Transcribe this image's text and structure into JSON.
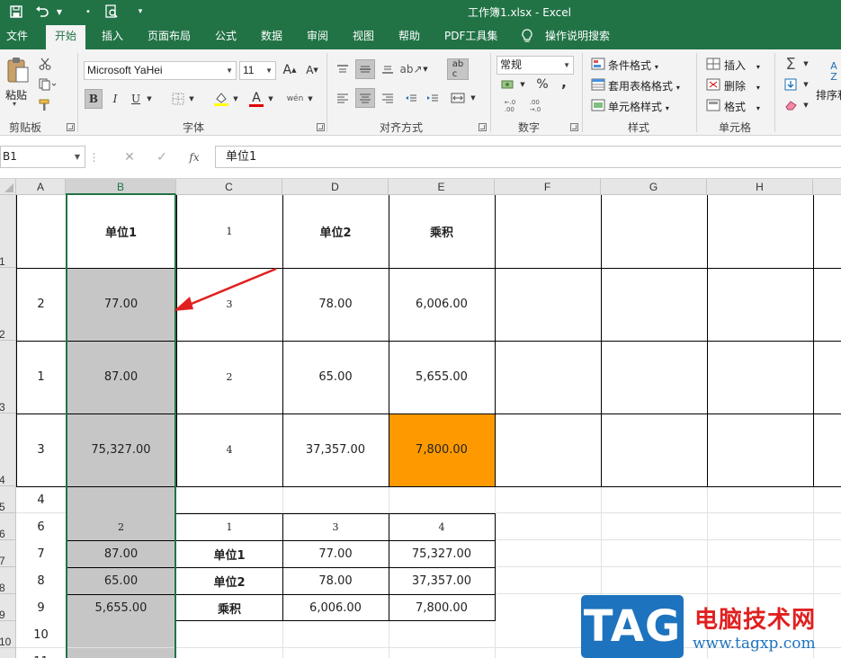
{
  "window": {
    "title": "工作簿1.xlsx  -  Excel"
  },
  "tabs": [
    "文件",
    "开始",
    "插入",
    "页面布局",
    "公式",
    "数据",
    "审阅",
    "视图",
    "帮助",
    "PDF工具集",
    "操作说明搜索"
  ],
  "ribbon": {
    "clipboard": {
      "paste": "粘贴",
      "label": "剪贴板"
    },
    "font": {
      "family": "Microsoft YaHei",
      "size": "11",
      "label": "字体",
      "bold": "B",
      "italic": "I",
      "underline": "U",
      "grow": "A",
      "shrink": "A",
      "font_color": "A"
    },
    "alignment": {
      "label": "对齐方式"
    },
    "number": {
      "format": "常规",
      "percent": "%",
      "comma": ",",
      "label": "数字"
    },
    "styles": {
      "conditional": "条件格式",
      "table": "套用表格格式",
      "cell_style": "单元格样式",
      "label": "样式"
    },
    "cells": {
      "insert": "插入",
      "delete": "删除",
      "format": "格式",
      "label": "单元格"
    },
    "editing": {
      "sort": "排序和"
    }
  },
  "formula_bar": {
    "name_box": "B1",
    "fx": "fx",
    "content": "单位1"
  },
  "columns": [
    "A",
    "B",
    "C",
    "D",
    "E",
    "F",
    "G",
    "H"
  ],
  "selected_column": "B",
  "rows": [
    "1",
    "2",
    "3",
    "4",
    "5",
    "6",
    "7",
    "8",
    "9",
    "10",
    "11"
  ],
  "cells": {
    "B1": "单位1",
    "C1": "1",
    "D1": "单位2",
    "E1": "乘积",
    "A2": "2",
    "B2": "77.00",
    "C2": "3",
    "D2": "78.00",
    "E2": "6,006.00",
    "A3": "1",
    "B3": "87.00",
    "C3": "2",
    "D3": "65.00",
    "E3": "5,655.00",
    "A4": "3",
    "B4": "75,327.00",
    "C4": "4",
    "D4": "37,357.00",
    "E4": "7,800.00",
    "A5": "4",
    "A6": "6",
    "B6": "2",
    "C6": "1",
    "D6": "3",
    "E6": "4",
    "A7": "7",
    "B7": "87.00",
    "C7": "单位1",
    "D7": "77.00",
    "E7": "75,327.00",
    "A8": "8",
    "B8": "65.00",
    "C8": "单位2",
    "D8": "78.00",
    "E8": "37,357.00",
    "A9": "9",
    "B9": "5,655.00",
    "C9": "乘积",
    "D9": "6,006.00",
    "E9": "7,800.00",
    "A10": "10",
    "A11": "11"
  },
  "colors": {
    "excel_green": "#217346",
    "selected_fill": "#c6c6c6",
    "highlight_fill": "#ff9900",
    "annotation_arrow": "#e02020"
  },
  "watermark": {
    "logo": "TAG",
    "site_name": "电脑技术网",
    "url": "www.tagxp.com"
  }
}
